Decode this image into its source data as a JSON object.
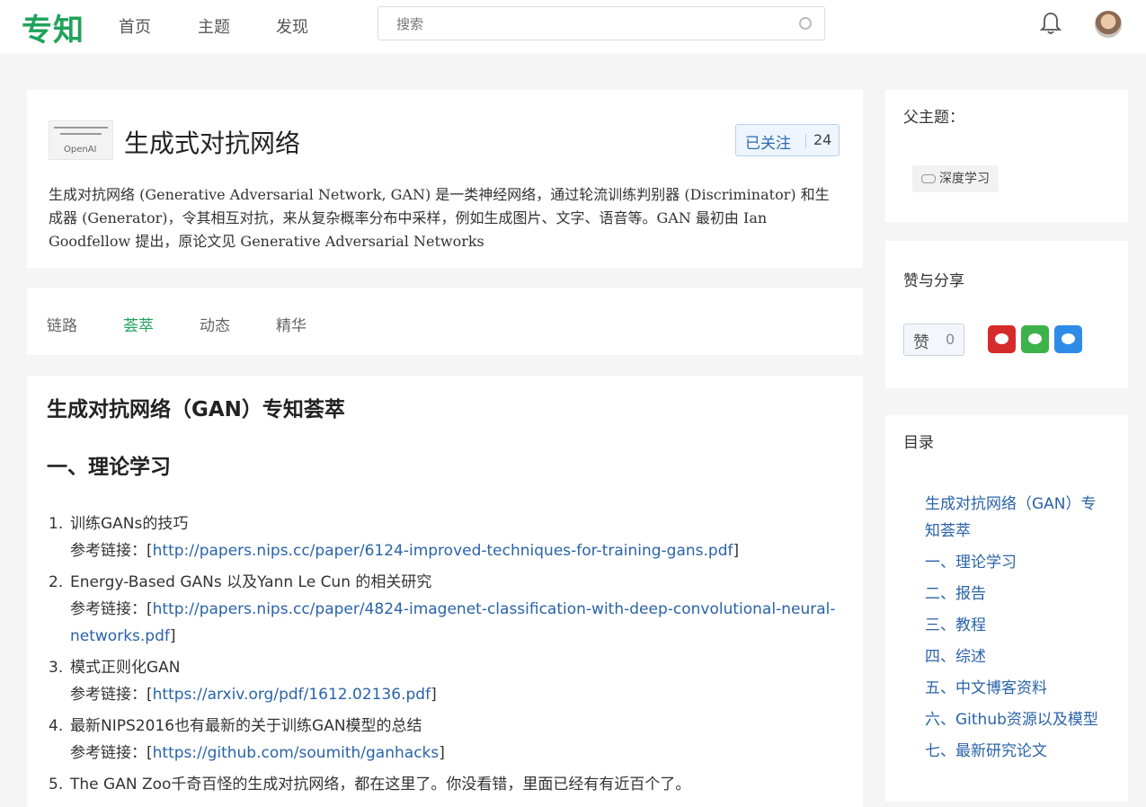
{
  "header": {
    "logo": "专知",
    "nav": [
      "首页",
      "主题",
      "发现"
    ],
    "search_placeholder": "搜索"
  },
  "topic": {
    "logo_text": "OpenAI",
    "title": "生成式对抗网络",
    "follow_label": "已关注",
    "follow_count": "24",
    "description": "生成对抗网络 (Generative Adversarial Network, GAN) 是一类神经网络，通过轮流训练判别器 (Discriminator) 和生成器 (Generator)，令其相互对抗，来从复杂概率分布中采样，例如生成图片、文字、语音等。GAN 最初由 Ian Goodfellow 提出，原论文见 Generative Adversarial Networks"
  },
  "tabs": [
    "链路",
    "荟萃",
    "动态",
    "精华"
  ],
  "content": {
    "title": "生成对抗网络（GAN）专知荟萃",
    "section": "一、理论学习",
    "items": [
      {
        "num": "1.",
        "text": "训练GANs的技巧",
        "ref_label": "参考链接：",
        "link": "http://papers.nips.cc/paper/6124-improved-techniques-for-training-gans.pdf"
      },
      {
        "num": "2.",
        "text": "Energy-Based GANs 以及Yann Le Cun 的相关研究",
        "ref_label": "参考链接：",
        "link": "http://papers.nips.cc/paper/4824-imagenet-classification-with-deep-convolutional-neural-networks.pdf"
      },
      {
        "num": "3.",
        "text": "模式正则化GAN",
        "ref_label": "参考链接：",
        "link": "https://arxiv.org/pdf/1612.02136.pdf"
      },
      {
        "num": "4.",
        "text": "最新NIPS2016也有最新的关于训练GAN模型的总结",
        "ref_label": "参考链接：",
        "link": "https://github.com/soumith/ganhacks"
      },
      {
        "num": "5.",
        "text": "The GAN Zoo千奇百怪的生成对抗网络，都在这里了。你没看错，里面已经有有近百个了。"
      }
    ]
  },
  "sidebar": {
    "parent_title": "父主题：",
    "parent_tag": "深度学习",
    "share_title": "赞与分享",
    "like_label": "赞",
    "like_count": "0",
    "toc_title": "目录",
    "toc": [
      "生成对抗网络（GAN）专知荟萃",
      "一、理论学习",
      "二、报告",
      "三、教程",
      "四、综述",
      "五、中文博客资料",
      "六、Github资源以及模型",
      "七、最新研究论文"
    ]
  },
  "colors": {
    "brand": "#1fa35b",
    "link": "#2a63a8",
    "weibo": "#d52b2b",
    "wechat": "#3db24a",
    "qq": "#2e8ce8"
  }
}
